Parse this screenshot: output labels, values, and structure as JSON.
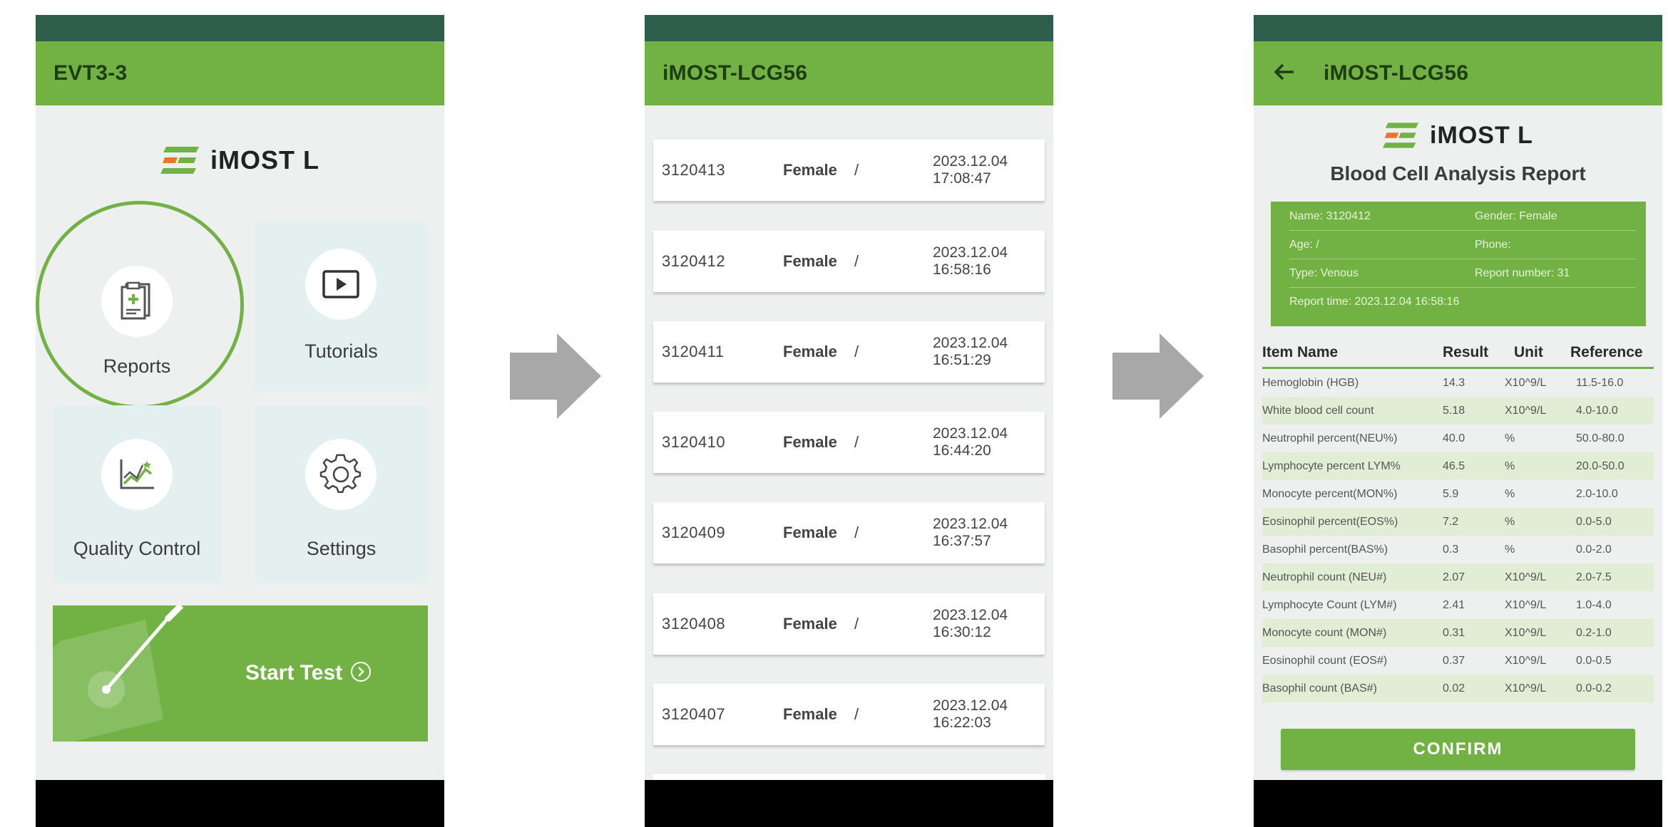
{
  "screen1": {
    "title": "EVT3-3",
    "logo_text": "iMOST L",
    "tiles": [
      {
        "label": "Reports",
        "icon": "report-icon"
      },
      {
        "label": "Tutorials",
        "icon": "play-icon"
      },
      {
        "label": "Quality Control",
        "icon": "chart-icon"
      },
      {
        "label": "Settings",
        "icon": "gear-icon"
      }
    ],
    "start_label": "Start Test"
  },
  "screen2": {
    "title": "iMOST-LCG56",
    "records": [
      {
        "id": "3120413",
        "gender": "Female",
        "age": "/",
        "date": "2023.12.04",
        "time": "17:08:47"
      },
      {
        "id": "3120412",
        "gender": "Female",
        "age": "/",
        "date": "2023.12.04",
        "time": "16:58:16"
      },
      {
        "id": "3120411",
        "gender": "Female",
        "age": "/",
        "date": "2023.12.04",
        "time": "16:51:29"
      },
      {
        "id": "3120410",
        "gender": "Female",
        "age": "/",
        "date": "2023.12.04",
        "time": "16:44:20"
      },
      {
        "id": "3120409",
        "gender": "Female",
        "age": "/",
        "date": "2023.12.04",
        "time": "16:37:57"
      },
      {
        "id": "3120408",
        "gender": "Female",
        "age": "/",
        "date": "2023.12.04",
        "time": "16:30:12"
      },
      {
        "id": "3120407",
        "gender": "Female",
        "age": "/",
        "date": "2023.12.04",
        "time": "16:22:03"
      }
    ]
  },
  "screen3": {
    "title": "iMOST-LCG56",
    "logo_text": "iMOST L",
    "report_title": "Blood Cell Analysis Report",
    "info": {
      "name": "Name: 3120412",
      "gender": "Gender: Female",
      "age": "Age: /",
      "phone": "Phone:",
      "type": "Type: Venous",
      "report_number": "Report number: 31",
      "report_time": "Report time: 2023.12.04 16:58:16"
    },
    "columns": [
      "Item Name",
      "Result",
      "Unit",
      "Reference"
    ],
    "rows": [
      {
        "name": "Hemoglobin (HGB)",
        "result": "14.3",
        "unit": "X10^9/L",
        "ref": "11.5-16.0"
      },
      {
        "name": "White blood cell count",
        "result": "5.18",
        "unit": "X10^9/L",
        "ref": "4.0-10.0"
      },
      {
        "name": "Neutrophil percent(NEU%)",
        "result": "40.0",
        "unit": "%",
        "ref": "50.0-80.0"
      },
      {
        "name": "Lymphocyte percent LYM%",
        "result": "46.5",
        "unit": "%",
        "ref": "20.0-50.0"
      },
      {
        "name": "Monocyte percent(MON%)",
        "result": "5.9",
        "unit": "%",
        "ref": "2.0-10.0"
      },
      {
        "name": "Eosinophil percent(EOS%)",
        "result": "7.2",
        "unit": "%",
        "ref": "0.0-5.0"
      },
      {
        "name": "Basophil percent(BAS%)",
        "result": "0.3",
        "unit": "%",
        "ref": "0.0-2.0"
      },
      {
        "name": "Neutrophil count (NEU#)",
        "result": "2.07",
        "unit": "X10^9/L",
        "ref": "2.0-7.5"
      },
      {
        "name": "Lymphocyte Count (LYM#)",
        "result": "2.41",
        "unit": "X10^9/L",
        "ref": "1.0-4.0"
      },
      {
        "name": "Monocyte count (MON#)",
        "result": "0.31",
        "unit": "X10^9/L",
        "ref": "0.2-1.0"
      },
      {
        "name": "Eosinophil count (EOS#)",
        "result": "0.37",
        "unit": "X10^9/L",
        "ref": "0.0-0.5"
      },
      {
        "name": "Basophil count (BAS#)",
        "result": "0.02",
        "unit": "X10^9/L",
        "ref": "0.0-0.2"
      }
    ],
    "confirm_label": "CONFIRM"
  },
  "colors": {
    "accent_green": "#72b244",
    "status_bar": "#2e5e4b",
    "screen_bg": "#eef0f0",
    "tile_bg": "#e4efef",
    "row_alt": "#e1eed5",
    "arrow": "#a8a8a8"
  }
}
